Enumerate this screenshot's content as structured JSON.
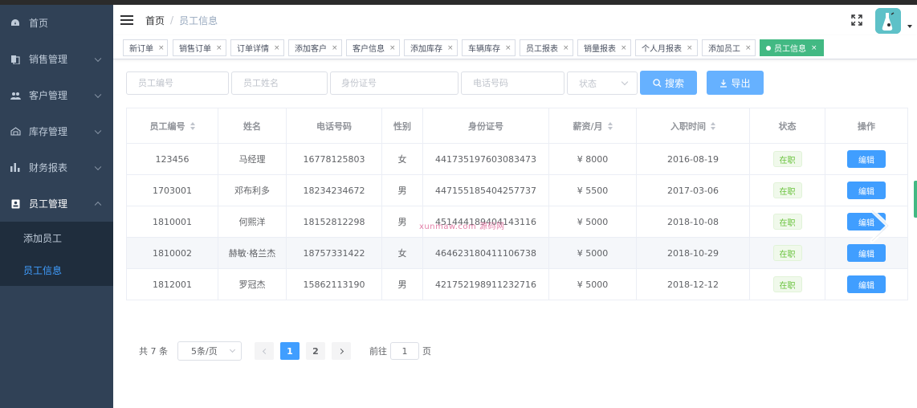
{
  "sidebar": {
    "items": [
      {
        "label": "首页",
        "icon": "dashboard-icon"
      },
      {
        "label": "销售管理",
        "icon": "clipboard-icon"
      },
      {
        "label": "客户管理",
        "icon": "people-icon"
      },
      {
        "label": "库存管理",
        "icon": "warehouse-icon"
      },
      {
        "label": "财务报表",
        "icon": "bar-chart-icon"
      },
      {
        "label": "员工管理",
        "icon": "id-badge-icon"
      }
    ],
    "submenu": [
      {
        "label": "添加员工"
      },
      {
        "label": "员工信息"
      }
    ]
  },
  "navbar": {
    "breadcrumb_home": "首页",
    "breadcrumb_separator": "/",
    "breadcrumb_current": "员工信息"
  },
  "tags": [
    {
      "label": "新订单"
    },
    {
      "label": "销售订单"
    },
    {
      "label": "订单详情"
    },
    {
      "label": "添加客户"
    },
    {
      "label": "客户信息"
    },
    {
      "label": "添加库存"
    },
    {
      "label": "车辆库存"
    },
    {
      "label": "员工报表"
    },
    {
      "label": "销量报表"
    },
    {
      "label": "个人月报表"
    },
    {
      "label": "添加员工"
    },
    {
      "label": "员工信息",
      "active": true
    }
  ],
  "tag_close": "×",
  "filters": {
    "employee_id_placeholder": "员工编号",
    "employee_name_placeholder": "员工姓名",
    "id_card_placeholder": "身份证号",
    "phone_placeholder": "电话号码",
    "status_placeholder": "状态",
    "search_label": "搜索",
    "export_label": "导出"
  },
  "table": {
    "headers": [
      "员工编号",
      "姓名",
      "电话号码",
      "性别",
      "身份证号",
      "薪资/月",
      "入职时间",
      "状态",
      "操作"
    ],
    "rows": [
      {
        "id": "123456",
        "name": "马经理",
        "phone": "16778125803",
        "gender": "女",
        "id_card": "441735197603083473",
        "salary": "¥ 8000",
        "hire_date": "2016-08-19",
        "status": "在职",
        "action": "编辑"
      },
      {
        "id": "1703001",
        "name": "邓布利多",
        "phone": "18234234672",
        "gender": "男",
        "id_card": "447155185404257737",
        "salary": "¥ 5500",
        "hire_date": "2017-03-06",
        "status": "在职",
        "action": "编辑"
      },
      {
        "id": "1810001",
        "name": "何熙洋",
        "phone": "18152812298",
        "gender": "男",
        "id_card": "451444189404143116",
        "salary": "¥ 5000",
        "hire_date": "2018-10-08",
        "status": "在职",
        "action": "编辑"
      },
      {
        "id": "1810002",
        "name": "赫敏·格兰杰",
        "phone": "18757331422",
        "gender": "女",
        "id_card": "464623180411106738",
        "salary": "¥ 5000",
        "hire_date": "2018-10-29",
        "status": "在职",
        "action": "编辑"
      },
      {
        "id": "1812001",
        "name": "罗冠杰",
        "phone": "15862113190",
        "gender": "男",
        "id_card": "421752198911232716",
        "salary": "¥ 5000",
        "hire_date": "2018-12-12",
        "status": "在职",
        "action": "编辑"
      }
    ]
  },
  "watermark": "xunmaw.com 源码网",
  "pagination": {
    "total": "共 7 条",
    "page_size": "5条/页",
    "pages": [
      "1",
      "2"
    ],
    "current_page": "1",
    "goto_prefix": "前往",
    "goto_value": "1",
    "goto_suffix": "页"
  },
  "colors": {
    "sidebar_bg": "#304156",
    "submenu_bg": "#1f2d3d",
    "active_tag": "#42b983",
    "primary": "#409eff",
    "primary_light": "#66b1ff",
    "status_green": "#67c23a"
  }
}
